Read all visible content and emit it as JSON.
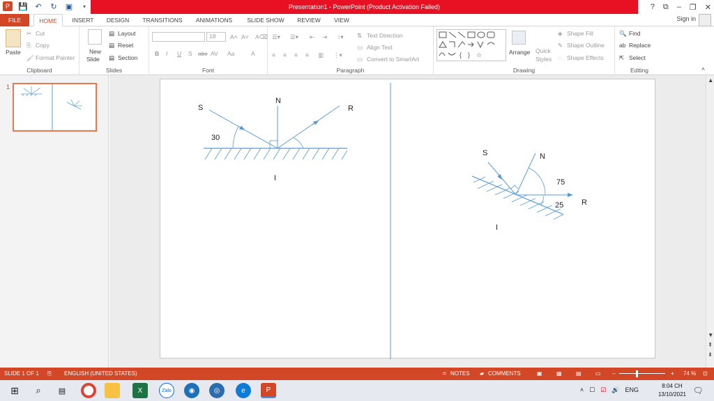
{
  "titlebar": {
    "title": "Presentation1 -  PowerPoint (Product Activation Failed)",
    "help": "?",
    "restore_ribbon": "⧉",
    "minimize": "–",
    "maximize": "❐",
    "close": "✕"
  },
  "tabs": {
    "file": "FILE",
    "home": "HOME",
    "insert": "INSERT",
    "design": "DESIGN",
    "transitions": "TRANSITIONS",
    "animations": "ANIMATIONS",
    "slideshow": "SLIDE SHOW",
    "review": "REVIEW",
    "view": "VIEW",
    "signin": "Sign in"
  },
  "ribbon": {
    "clipboard": {
      "label": "Clipboard",
      "paste": "Paste",
      "cut": "Cut",
      "copy": "Copy",
      "format_painter": "Format Painter"
    },
    "slides": {
      "label": "Slides",
      "new_slide_1": "New",
      "new_slide_2": "Slide",
      "layout": "Layout",
      "reset": "Reset",
      "section": "Section"
    },
    "font": {
      "label": "Font",
      "size": "18",
      "bold": "B",
      "italic": "I",
      "underline": "U",
      "shadow": "S",
      "strike": "abc",
      "spacing": "AV",
      "case": "Aa",
      "color": "A"
    },
    "paragraph": {
      "label": "Paragraph",
      "text_direction": "Text Direction",
      "align_text": "Align Text",
      "smartart": "Convert to SmartArt"
    },
    "drawing": {
      "label": "Drawing",
      "arrange": "Arrange",
      "quick_styles_1": "Quick",
      "quick_styles_2": "Styles",
      "shape_fill": "Shape Fill",
      "shape_outline": "Shape Outline",
      "shape_effects": "Shape Effects"
    },
    "editing": {
      "label": "Editing",
      "find": "Find",
      "replace": "Replace",
      "select": "Select"
    }
  },
  "thumbnails": {
    "slide_number": "1"
  },
  "slide": {
    "left_diagram": {
      "S": "S",
      "N": "N",
      "R": "R",
      "angle": "30",
      "I": "I"
    },
    "right_diagram": {
      "S": "S",
      "N": "N",
      "R": "R",
      "angle_top": "75",
      "angle_bottom": "25",
      "I": "I"
    }
  },
  "statusbar": {
    "slide_info": "SLIDE 1 OF 1",
    "language": "ENGLISH (UNITED STATES)",
    "notes": "NOTES",
    "comments": "COMMENTS",
    "zoom": "74 %"
  },
  "taskbar": {
    "time": "8:04 CH",
    "date": "13/10/2021",
    "lang": "ENG"
  },
  "colors": {
    "accent": "#d24726",
    "title_red": "#e81123",
    "diagram": "#5b9bd5"
  }
}
